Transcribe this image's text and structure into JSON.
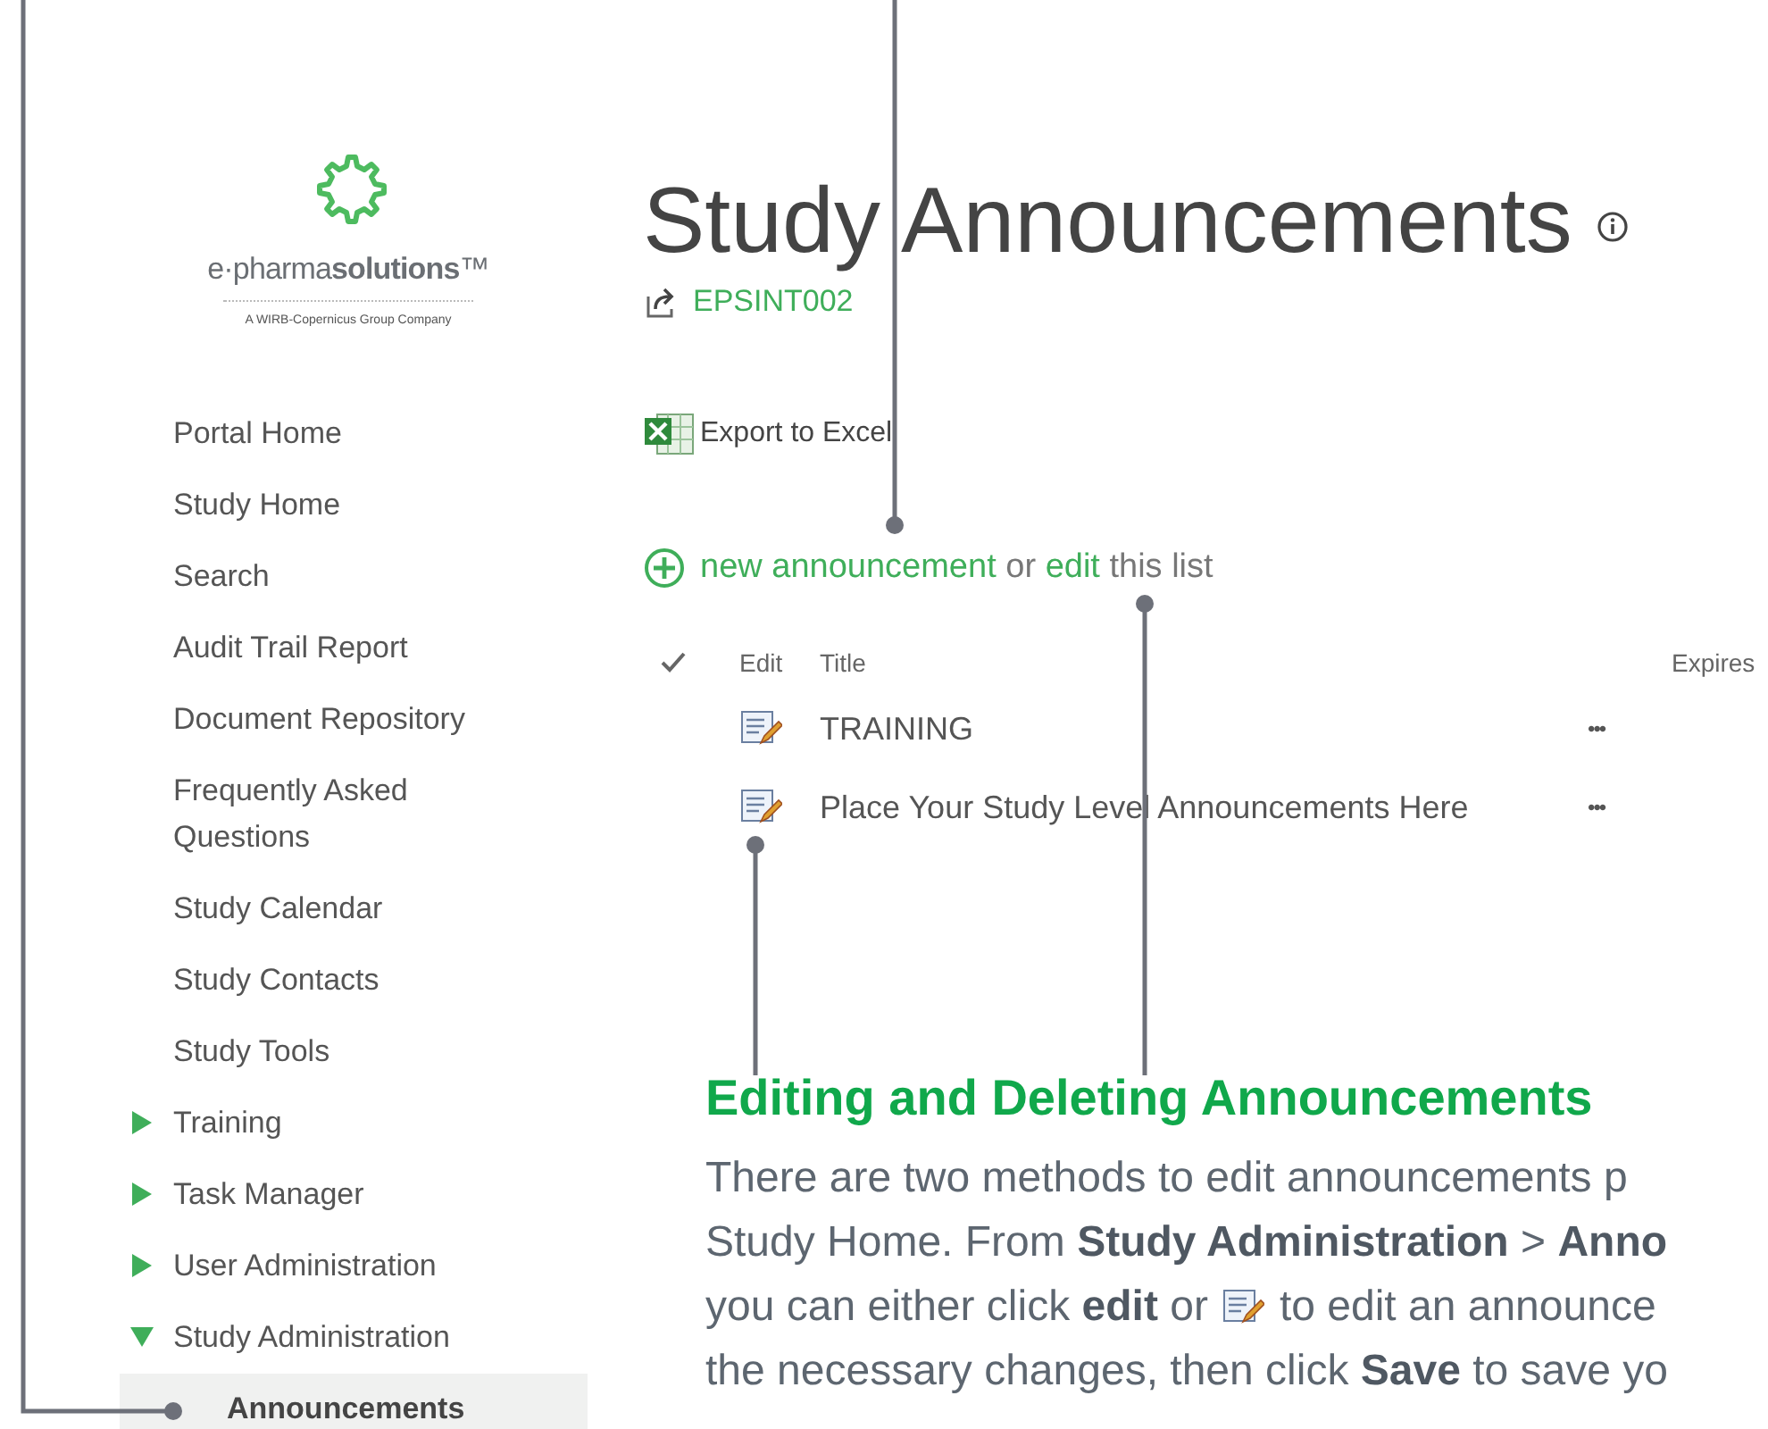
{
  "logo": {
    "brand": "e·pharma**solutions**™",
    "tagline": "A WIRB-Copernicus Group Company"
  },
  "nav": [
    {
      "kind": "link",
      "label": "Portal Home",
      "selected": false
    },
    {
      "kind": "link",
      "label": "Study Home",
      "selected": false
    },
    {
      "kind": "link",
      "label": "Search",
      "selected": false
    },
    {
      "kind": "link",
      "label": "Audit Trail Report",
      "selected": false
    },
    {
      "kind": "link",
      "label": "Document Repository",
      "selected": false
    },
    {
      "kind": "link",
      "label": "Frequently Asked Questions",
      "selected": false
    },
    {
      "kind": "link",
      "label": "Study Calendar",
      "selected": false
    },
    {
      "kind": "link",
      "label": "Study Contacts",
      "selected": false
    },
    {
      "kind": "link",
      "label": "Study Tools",
      "selected": false
    },
    {
      "kind": "group",
      "label": "Training",
      "selected": false,
      "expanded": false
    },
    {
      "kind": "group",
      "label": "Task Manager",
      "selected": false,
      "expanded": false
    },
    {
      "kind": "group",
      "label": "User Administration",
      "selected": false,
      "expanded": false
    },
    {
      "kind": "group",
      "label": "Study Administration",
      "selected": false,
      "expanded": true,
      "children": [
        {
          "label": "Announcements",
          "selected": true
        }
      ]
    }
  ],
  "page": {
    "title": "Study Announcements",
    "site": "EPSINT002"
  },
  "toolbar": {
    "export": "Export to Excel"
  },
  "add_line": [
    {
      "kind": "link",
      "text": "new announcement"
    },
    {
      "kind": "text",
      "text": "or"
    },
    {
      "kind": "link",
      "text": "edit"
    },
    {
      "kind": "text",
      "text": "this list"
    }
  ],
  "table": {
    "columns": [
      "Edit",
      "Title",
      "Expires"
    ],
    "rows": [
      {
        "title": "TRAINING",
        "menu": "•••"
      },
      {
        "title": "Place Your Study Level Announcements Here",
        "menu": "•••"
      }
    ]
  },
  "help": {
    "heading": "Editing and Deleting Announcements",
    "lines": [
      {
        "kind": "text",
        "text": "There are two methods to edit announcements p"
      },
      {
        "kind": "text",
        "text": "Study Home. From **Study Administration** > **Anno**"
      },
      {
        "kind": "icon",
        "before": "you can either click **edit** or",
        "after": "to edit an announce"
      },
      {
        "kind": "text",
        "text": "the necessary changes, then click **Save** to save yo"
      }
    ]
  }
}
